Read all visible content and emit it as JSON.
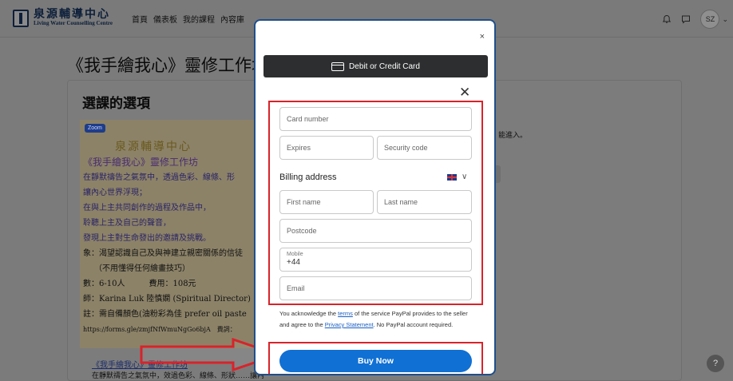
{
  "header": {
    "logo_cn": "泉源輔導中心",
    "logo_en": "Living Water Counselling Centre",
    "nav": [
      "首頁",
      "儀表板",
      "我的課程",
      "內容庫"
    ],
    "avatar_initials": "SZ",
    "avatar_caret": "⌄",
    "bell_icon": "bell-icon",
    "chat_icon": "chat-icon"
  },
  "page": {
    "title": "《我手繪我心》靈修工作坊",
    "section_title": "選課的選項",
    "zoom_badge": "Zoom",
    "poster_org": "泉源輔導中心",
    "poster_title": "《我手繪我心》靈修工作坊",
    "poster_lines": [
      "在靜默禱告之氣氛中，透過色彩、線條、形",
      "讓內心世界浮現；",
      "在與上主共同創作的過程及作品中，",
      "聆聽上主及自己的聲音，",
      "發現上主對生命發出的邀請及挑戰。",
      "象：渴望認識自己及與神建立親密關係的信徒",
      "（不用懂得任何繪畫技巧）",
      "數：6-10人　　　費用：108元",
      "師：Karina Luk 陸慎嫻 (Spiritual Director)",
      "註：需自備顏色(油粉彩為佳 prefer oil paste",
      "https://forms.gle/zmjfNfWmuNgGo6bjA　費詞："
    ],
    "link_text": "《我手繪我心》靈修工作坊",
    "line_text": "在靜默禱告之氣氛中，效過色彩、線條、形狀……讓內",
    "right_text": "能進入。",
    "help_label": "?"
  },
  "modal": {
    "close_label": "×",
    "card_button_label": "Debit or Credit Card",
    "x_close_label": "✕",
    "fields": {
      "card_number": "Card number",
      "expires": "Expires",
      "security_code": "Security code",
      "first_name": "First name",
      "last_name": "Last name",
      "postcode": "Postcode",
      "mobile_label": "Mobile",
      "mobile_value": "+44",
      "email": "Email"
    },
    "billing_label": "Billing address",
    "billing_chevron": "∨",
    "ack_pre": "You acknowledge the ",
    "ack_terms": "terms",
    "ack_mid": " of the service PayPal provides to the seller and agree to the ",
    "ack_privacy": "Privacy Statement",
    "ack_post": ". No PayPal account required.",
    "buy_label": "Buy Now"
  },
  "colors": {
    "highlight_red": "#d8232a",
    "paypal_blue": "#1070d4",
    "card_bar": "#2c2e2f"
  }
}
